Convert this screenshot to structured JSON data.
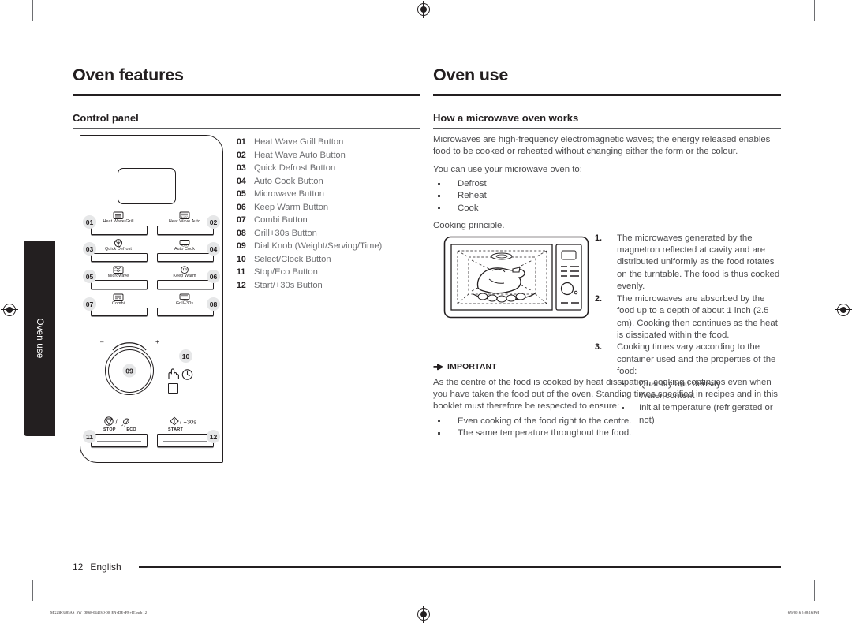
{
  "document": {
    "side_tab_label": "Oven use",
    "page_number": "12",
    "language": "English",
    "footer_file": "MG23K3585AS_SW_DE68-04403Q-00_EN+DE+FR+IT.indb   12",
    "footer_timestamp": "6/9/2016   5:08:16 PM"
  },
  "left_column": {
    "chapter_title": "Oven features",
    "section_title": "Control panel",
    "legend": [
      {
        "num": "01",
        "label": "Heat Wave Grill Button"
      },
      {
        "num": "02",
        "label": "Heat Wave Auto Button"
      },
      {
        "num": "03",
        "label": "Quick Defrost Button"
      },
      {
        "num": "04",
        "label": "Auto Cook Button"
      },
      {
        "num": "05",
        "label": "Microwave Button"
      },
      {
        "num": "06",
        "label": "Keep Warm Button"
      },
      {
        "num": "07",
        "label": "Combi Button"
      },
      {
        "num": "08",
        "label": "Grill+30s Button"
      },
      {
        "num": "09",
        "label": "Dial Knob (Weight/Serving/Time)"
      },
      {
        "num": "10",
        "label": "Select/Clock Button"
      },
      {
        "num": "11",
        "label": "Stop/Eco Button"
      },
      {
        "num": "12",
        "label": "Start/+30s Button"
      }
    ],
    "panel": {
      "buttons": [
        {
          "key": "01",
          "caption": "Heat Wave Grill",
          "side": "left"
        },
        {
          "key": "02",
          "caption": "Heat Wave Auto",
          "side": "right"
        },
        {
          "key": "03",
          "caption": "Quick Defrost",
          "side": "left"
        },
        {
          "key": "04",
          "caption": "Auto Cook",
          "side": "right"
        },
        {
          "key": "05",
          "caption": "Microwave",
          "side": "left"
        },
        {
          "key": "06",
          "caption": "Keep Warm",
          "side": "right"
        },
        {
          "key": "07",
          "caption": "Combi",
          "side": "left"
        },
        {
          "key": "08",
          "caption": "Grill+30s",
          "side": "right"
        }
      ],
      "dial_key": "09",
      "dial_minus": "–",
      "dial_plus": "+",
      "select_clock_key": "10",
      "stop_key": "11",
      "stop_caption_1": "STOP",
      "stop_caption_2": "ECO",
      "stop_separator": "/",
      "start_key": "12",
      "start_caption": "START",
      "start_suffix": "/+30s"
    }
  },
  "right_column": {
    "chapter_title": "Oven use",
    "section_title": "How a microwave oven works",
    "intro": "Microwaves are high-frequency electromagnetic waves; the energy released enables food to be cooked or reheated without changing either the form or the colour.",
    "uses_lead": "You can use your microwave oven to:",
    "uses": [
      "Defrost",
      "Reheat",
      "Cook"
    ],
    "principle_lead": "Cooking principle.",
    "principle": [
      {
        "num": "1.",
        "text": "The microwaves generated by the magnetron reflected at cavity and are distributed uniformly as the food rotates on the turntable. The food is thus cooked evenly."
      },
      {
        "num": "2.",
        "text": "The microwaves are absorbed by the food up to a depth of about 1 inch (2.5 cm). Cooking then continues as the heat is dissipated within the food."
      },
      {
        "num": "3.",
        "text": "Cooking times vary according to the container used and the properties of the food:"
      }
    ],
    "principle_sub": [
      "Quantity and density",
      "Water content",
      "Initial temperature (refrigerated or not)"
    ],
    "important_label": "IMPORTANT",
    "important_body": "As the centre of the food is cooked by heat dissipation, cooking continues even when you have taken the food out of the oven. Standing times specified in recipes and in this booklet must therefore be respected to ensure:",
    "important_bullets": [
      "Even cooking of the food right to the centre.",
      "The same temperature throughout the food."
    ]
  }
}
